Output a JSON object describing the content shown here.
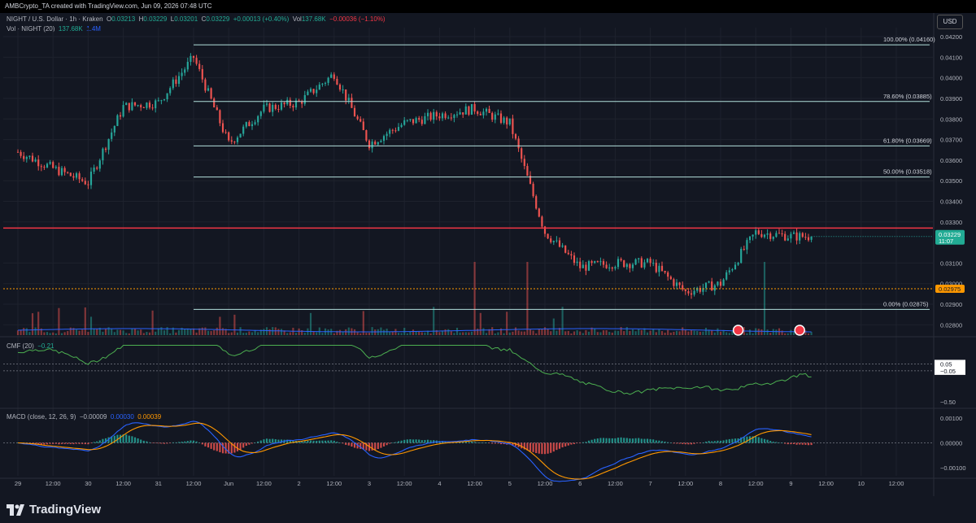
{
  "header": {
    "created_by": "AMBCrypto_TA created with TradingView.com, Jun 09, 2026 07:48 UTC",
    "symbol": "NIGHT / U.S. Dollar · 1h · Kraken",
    "ohlc": {
      "O": "0.03213",
      "H": "0.03229",
      "L": "0.03201",
      "C": "0.03229",
      "change": "+0.00013 (+0.40%)"
    },
    "vol_label": "Vol",
    "vol_value": "137.68K",
    "vol_change": "−0.00036 (−1.10%)",
    "vol_indicator": "Vol · NIGHT (20)",
    "vol_ind_value": "137.68K",
    "vol_ind_ma": "1.4M",
    "currency_button": "USD"
  },
  "price_axis": {
    "ticks": [
      "0.04200",
      "0.04100",
      "0.04000",
      "0.03900",
      "0.03800",
      "0.03700",
      "0.03600",
      "0.03500",
      "0.03400",
      "0.03300",
      "0.03100",
      "0.03000",
      "0.02900",
      "0.02800"
    ],
    "current_price": "0.03229",
    "countdown": "11:07",
    "level_badge": "0.02975"
  },
  "fib_levels": [
    {
      "label": "100.00% (0.04160)",
      "value": 0.0416
    },
    {
      "label": "78.60% (0.03885)",
      "value": 0.03885
    },
    {
      "label": "61.80% (0.03669)",
      "value": 0.03669
    },
    {
      "label": "50.00% (0.03518)",
      "value": 0.03518
    },
    {
      "label": "0.00% (0.02875)",
      "value": 0.02875
    }
  ],
  "horizontal_levels": [
    {
      "value": 0.0327,
      "color": "#f23645",
      "style": "solid"
    },
    {
      "value": 0.02975,
      "color": "#ff9800",
      "style": "dotted"
    }
  ],
  "cmf": {
    "label": "CMF (20)",
    "value": "−0.21",
    "axis_ticks": [
      "0.05",
      "−0.05",
      "−0.50"
    ]
  },
  "macd": {
    "label": "MACD (close, 12, 26, 9)",
    "hist": "−0.00009",
    "macd": "0.00030",
    "signal": "0.00039",
    "axis_ticks": [
      "0.00100",
      "0.00000",
      "−0.00100"
    ]
  },
  "time_axis": {
    "labels": [
      "29",
      "12:00",
      "30",
      "12:00",
      "31",
      "12:00",
      "Jun",
      "12:00",
      "2",
      "12:00",
      "3",
      "12:00",
      "4",
      "12:00",
      "5",
      "12:00",
      "6",
      "12:00",
      "7",
      "12:00",
      "8",
      "12:00",
      "9",
      "12:00",
      "10",
      "12:00"
    ]
  },
  "branding": {
    "logo_text": "TradingView"
  },
  "colors": {
    "up": "#26a69a",
    "down": "#ef5350",
    "fib": "#b2dfdb",
    "cmf": "#4caf50",
    "macd": "#2962ff",
    "signal": "#ff9800"
  },
  "chart_data": {
    "type": "candlestick",
    "title": "NIGHT / U.S. Dollar · 1h · Kraken",
    "interval": "1h",
    "ylim": [
      0.0275,
      0.0422
    ],
    "x_range": [
      "May 29",
      "Jun 10 12:00"
    ],
    "close_anchors": [
      {
        "t": "May 29 00:00",
        "v": 0.0364
      },
      {
        "t": "May 29 12:00",
        "v": 0.0356
      },
      {
        "t": "May 30 00:00",
        "v": 0.0349
      },
      {
        "t": "May 30 12:00",
        "v": 0.0386
      },
      {
        "t": "May 31 00:00",
        "v": 0.0388
      },
      {
        "t": "May 31 12:00",
        "v": 0.041
      },
      {
        "t": "Jun 1 00:00",
        "v": 0.0368
      },
      {
        "t": "Jun 1 12:00",
        "v": 0.0385
      },
      {
        "t": "Jun 2 00:00",
        "v": 0.0388
      },
      {
        "t": "Jun 2 12:00",
        "v": 0.0402
      },
      {
        "t": "Jun 3 00:00",
        "v": 0.0368
      },
      {
        "t": "Jun 3 12:00",
        "v": 0.0378
      },
      {
        "t": "Jun 4 00:00",
        "v": 0.0382
      },
      {
        "t": "Jun 4 12:00",
        "v": 0.0385
      },
      {
        "t": "Jun 5 00:00",
        "v": 0.0378
      },
      {
        "t": "Jun 5 12:00",
        "v": 0.0325
      },
      {
        "t": "Jun 6 00:00",
        "v": 0.0308
      },
      {
        "t": "Jun 6 12:00",
        "v": 0.031
      },
      {
        "t": "Jun 7 00:00",
        "v": 0.031
      },
      {
        "t": "Jun 7 12:00",
        "v": 0.0296
      },
      {
        "t": "Jun 8 00:00",
        "v": 0.03
      },
      {
        "t": "Jun 8 12:00",
        "v": 0.0325
      },
      {
        "t": "Jun 9 00:00",
        "v": 0.0323
      },
      {
        "t": "Jun 9 07:00",
        "v": 0.03229
      }
    ],
    "volume_spikes": [
      "Jun 4 12:00",
      "Jun 5 06:00",
      "Jun 8 15:00"
    ],
    "cmf_range": [
      -0.5,
      0.35
    ],
    "macd_range": [
      -0.0012,
      0.0012
    ]
  }
}
